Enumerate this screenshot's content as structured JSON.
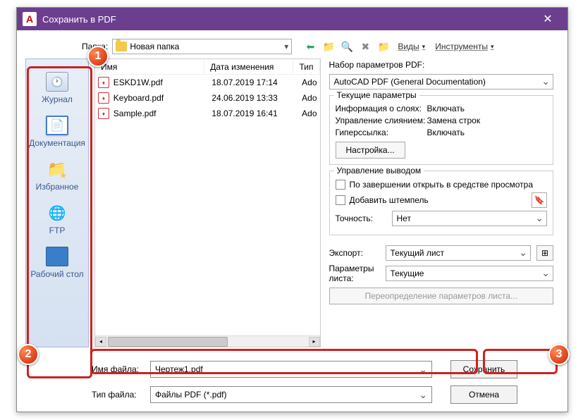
{
  "window": {
    "title": "Сохранить в PDF",
    "close": "✕"
  },
  "topbar": {
    "folder_label": "Папка:",
    "folder_value": "Новая папка",
    "menu_views": "Виды",
    "menu_tools": "Инструменты"
  },
  "sidebar": {
    "items": [
      {
        "label": "Журнал"
      },
      {
        "label": "Документация"
      },
      {
        "label": "Избранное"
      },
      {
        "label": "FTP"
      },
      {
        "label": "Рабочий стол"
      }
    ]
  },
  "filelist": {
    "col_name": "Имя",
    "col_date": "Дата изменения",
    "col_type": "Тип",
    "rows": [
      {
        "name": "ESKD1W.pdf",
        "date": "18.07.2019 17:14",
        "type": "Ado"
      },
      {
        "name": "Keyboard.pdf",
        "date": "24.06.2019 13:33",
        "type": "Ado"
      },
      {
        "name": "Sample.pdf",
        "date": "18.07.2019 16:41",
        "type": "Ado"
      }
    ]
  },
  "pdf": {
    "preset_label": "Набор параметров PDF:",
    "preset_value": "AutoCAD PDF (General Documentation)",
    "current_title": "Текущие параметры",
    "p_layers": "Информация о слоях:",
    "v_layers": "Включать",
    "p_merge": "Управление слиянием:",
    "v_merge": "Замена строк",
    "p_hyper": "Гиперссылка:",
    "v_hyper": "Включать",
    "settings_btn": "Настройка...",
    "output_title": "Управление выводом",
    "chk_open": "По завершении открыть в средстве просмотра",
    "chk_stamp": "Добавить штемпель",
    "precision_label": "Точность:",
    "precision_value": "Нет",
    "export_label": "Экспорт:",
    "export_value": "Текущий лист",
    "sheetparam_label": "Параметры листа:",
    "sheetparam_value": "Текущие",
    "override_btn": "Переопределение параметров листа..."
  },
  "bottom": {
    "filename_label": "Имя файла:",
    "filename_value": "Чертеж1.pdf",
    "filetype_label": "Тип файла:",
    "filetype_value": "Файлы PDF (*.pdf)",
    "save_btn": "Сохранить",
    "cancel_btn": "Отмена"
  },
  "callouts": {
    "c1": "1",
    "c2": "2",
    "c3": "3"
  }
}
